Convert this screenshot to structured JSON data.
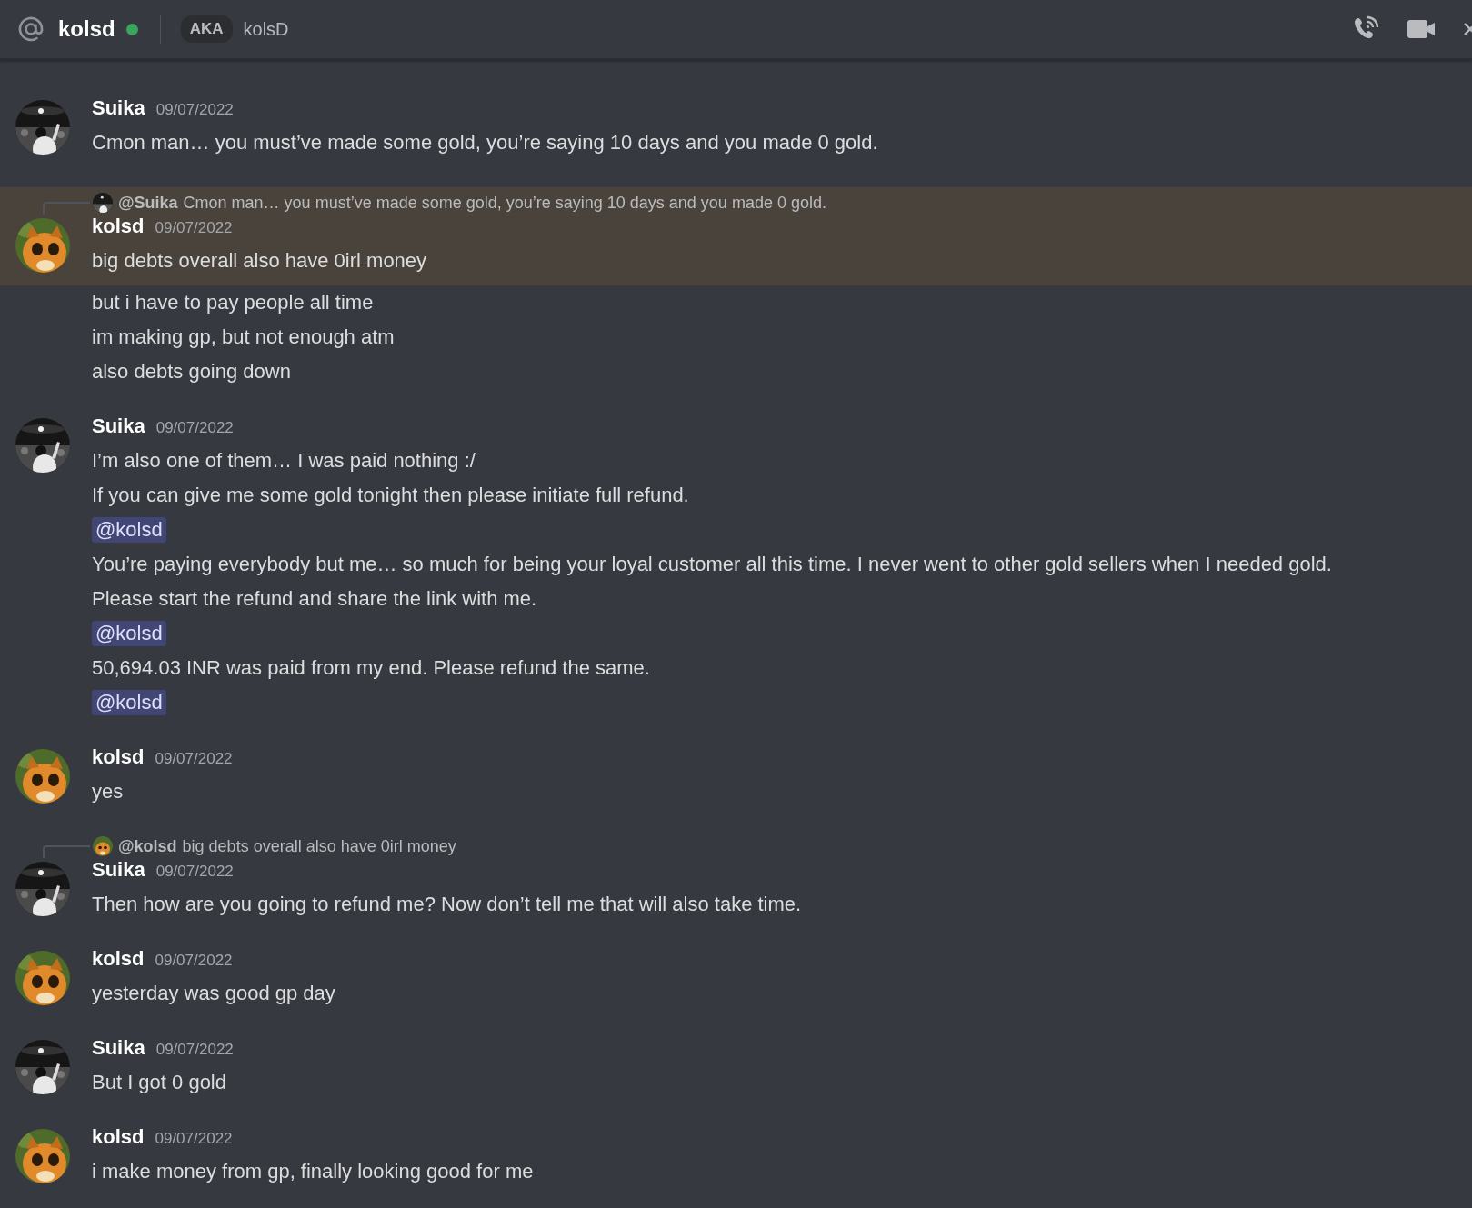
{
  "header": {
    "name": "kolsd",
    "online": true,
    "aka_badge": "AKA",
    "aka_name": "kolsD"
  },
  "messages": [
    {
      "author": "Suika",
      "timestamp": "09/07/2022",
      "highlighted": false,
      "lines": [
        {
          "kind": "text",
          "text": "Cmon man… you must’ve made some gold, you’re saying 10 days and you made 0 gold."
        }
      ]
    },
    {
      "author": "kolsd",
      "timestamp": "09/07/2022",
      "highlighted": true,
      "reply": {
        "author": "@Suika",
        "text": "Cmon man… you must’ve made some gold, you’re saying 10 days and you made 0 gold."
      },
      "lines": [
        {
          "kind": "text",
          "text": "big debts overall also have 0irl money"
        }
      ]
    },
    {
      "highlighted": false,
      "continuation": true,
      "lines": [
        {
          "kind": "text",
          "text": "but i have to pay people all time"
        },
        {
          "kind": "text",
          "text": "im making gp, but not enough atm"
        },
        {
          "kind": "text",
          "text": "also debts going down"
        }
      ]
    },
    {
      "author": "Suika",
      "timestamp": "09/07/2022",
      "highlighted": false,
      "lines": [
        {
          "kind": "text",
          "text": "I’m also one of them… I was paid nothing :/"
        },
        {
          "kind": "text",
          "text": "If you can give me some gold tonight then please initiate full refund."
        },
        {
          "kind": "mention",
          "text": "@kolsd"
        },
        {
          "kind": "text",
          "text": "You’re paying everybody but me… so much for being your loyal customer all this time. I never went to other gold sellers when I needed gold."
        },
        {
          "kind": "text",
          "text": "Please start the refund and share the link with me."
        },
        {
          "kind": "mention",
          "text": "@kolsd"
        },
        {
          "kind": "text",
          "text": "50,694.03 INR was paid from my end. Please refund the same."
        },
        {
          "kind": "mention",
          "text": "@kolsd"
        }
      ]
    },
    {
      "author": "kolsd",
      "timestamp": "09/07/2022",
      "highlighted": false,
      "lines": [
        {
          "kind": "text",
          "text": "yes"
        }
      ]
    },
    {
      "author": "Suika",
      "timestamp": "09/07/2022",
      "highlighted": false,
      "reply": {
        "author": "@kolsd",
        "text": "big debts overall also have 0irl money"
      },
      "lines": [
        {
          "kind": "text",
          "text": "Then how are you going to refund me? Now don’t tell me that will also take time."
        }
      ]
    },
    {
      "author": "kolsd",
      "timestamp": "09/07/2022",
      "highlighted": false,
      "lines": [
        {
          "kind": "text",
          "text": "yesterday was good gp day"
        }
      ]
    },
    {
      "author": "Suika",
      "timestamp": "09/07/2022",
      "highlighted": false,
      "lines": [
        {
          "kind": "text",
          "text": "But I got 0 gold"
        }
      ]
    },
    {
      "author": "kolsd",
      "timestamp": "09/07/2022",
      "highlighted": false,
      "lines": [
        {
          "kind": "text",
          "text": "i make money from gp, finally looking good for me"
        }
      ]
    }
  ]
}
